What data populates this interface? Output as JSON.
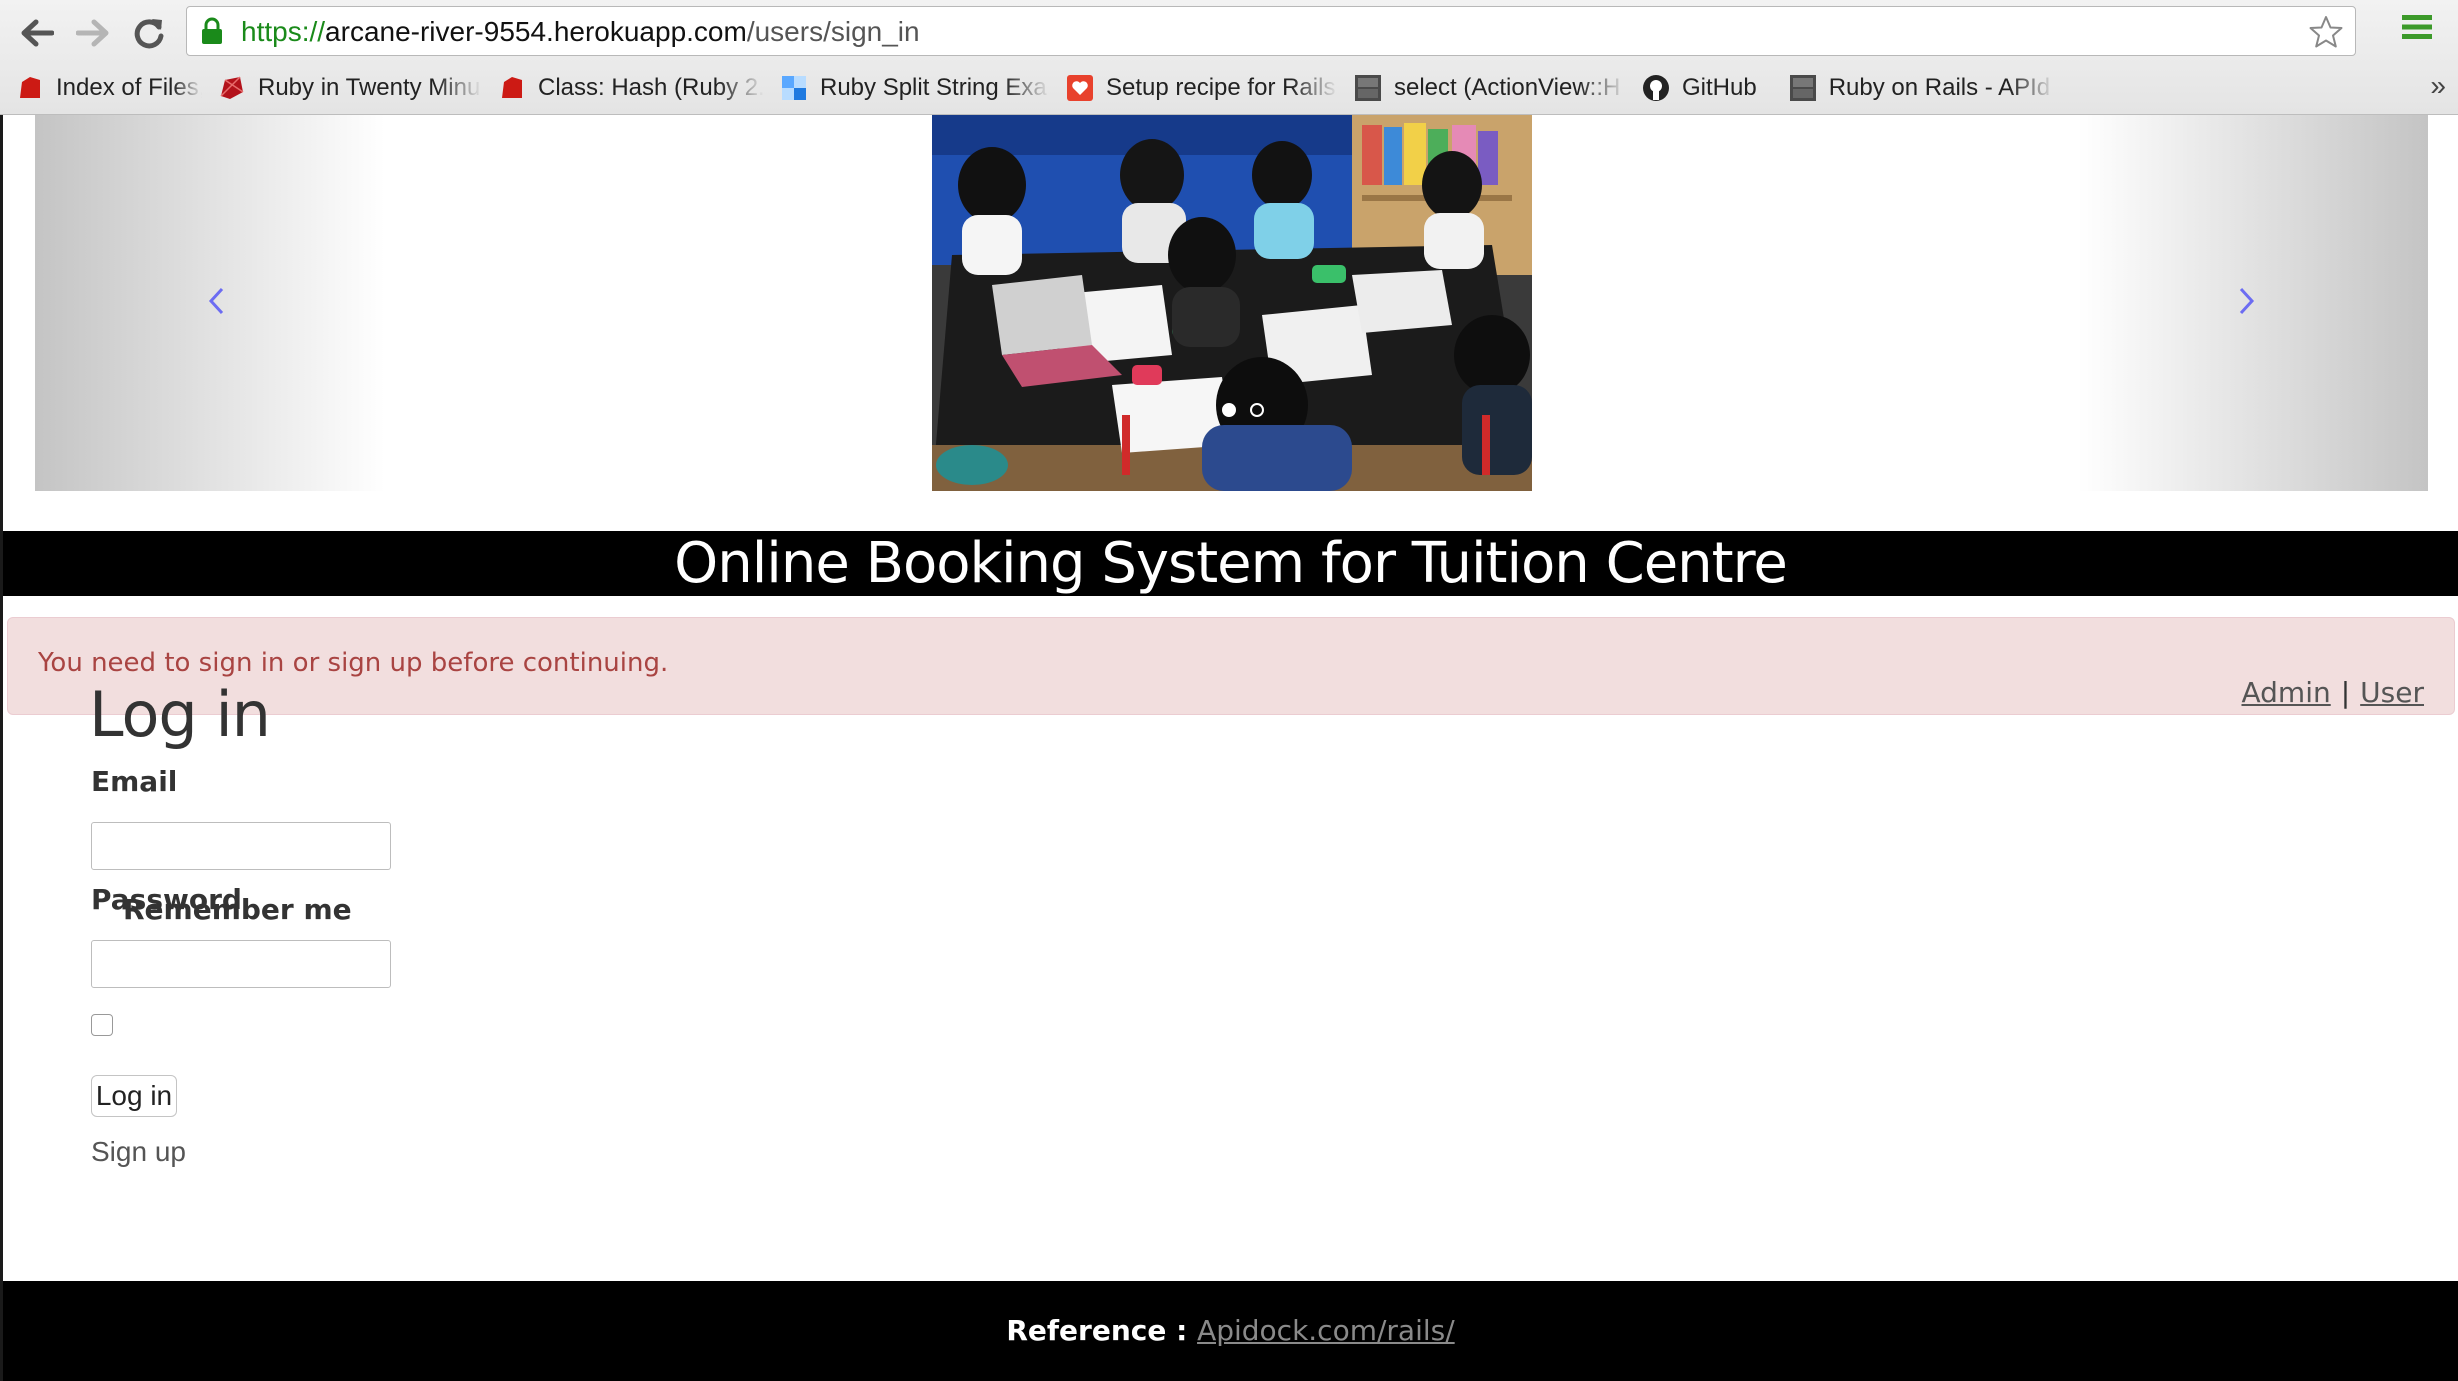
{
  "browser": {
    "url_scheme": "https://",
    "url_host": "arcane-river-9554.herokuapp.com",
    "url_path": "/users/sign_in",
    "bookmarks": [
      {
        "label": "Index of Files, Classe",
        "icon": "ruby-icon"
      },
      {
        "label": "Ruby in Twenty Minu",
        "icon": "ruby-gem-icon"
      },
      {
        "label": "Class: Hash (Ruby 2.",
        "icon": "ruby-icon"
      },
      {
        "label": "Ruby Split String Exa",
        "icon": "blue-square-icon"
      },
      {
        "label": "Setup recipe for Rails",
        "icon": "heart-icon"
      },
      {
        "label": "select (ActionView::H",
        "icon": "apidock-icon"
      },
      {
        "label": "GitHub",
        "icon": "github-icon"
      },
      {
        "label": "Ruby on Rails - APId",
        "icon": "apidock-icon"
      }
    ],
    "overflow_label": "»"
  },
  "carousel": {
    "indicator_count": 2,
    "active_index": 0
  },
  "site": {
    "title": "Online Booking System for Tuition Centre"
  },
  "alert": {
    "message": "You need to sign in or sign up before continuing."
  },
  "login": {
    "heading": "Log in",
    "email_label": "Email",
    "email_value": "",
    "password_label": "Password",
    "password_value": "",
    "remember_label": "Remember me",
    "remember_checked": false,
    "submit_label": "Log in",
    "signup_label": "Sign up"
  },
  "top_links": {
    "admin": "Admin",
    "separator": "|",
    "user": "User"
  },
  "footer": {
    "reference_label": "Reference :",
    "reference_link": "Apidock.com/rails/"
  },
  "colors": {
    "alert_bg": "#f2dede",
    "alert_text": "#a94442",
    "bar_bg": "#000000",
    "url_green": "#1a8a1a"
  }
}
